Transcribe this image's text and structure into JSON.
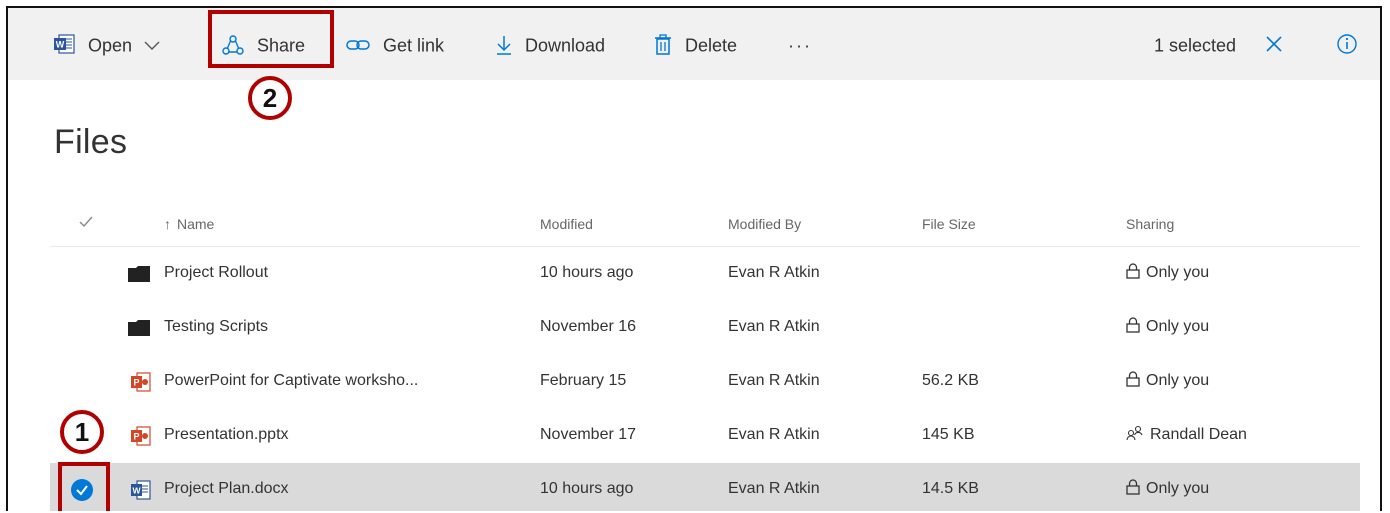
{
  "toolbar": {
    "open_label": "Open",
    "share_label": "Share",
    "get_link_label": "Get link",
    "download_label": "Download",
    "delete_label": "Delete",
    "more_label": "···",
    "selection_status": "1 selected"
  },
  "page_title": "Files",
  "columns": {
    "name": "Name",
    "modified": "Modified",
    "modified_by": "Modified By",
    "file_size": "File Size",
    "sharing": "Sharing"
  },
  "rows": [
    {
      "name": "Project Rollout",
      "modified": "10 hours ago",
      "modified_by": "Evan R Atkin",
      "size": "",
      "sharing": "Only you",
      "type": "folder-icon"
    },
    {
      "name": "Testing Scripts",
      "modified": "November 16",
      "modified_by": "Evan R Atkin",
      "size": "",
      "sharing": "Only you",
      "type": "folder-icon"
    },
    {
      "name": "PowerPoint for Captivate worksho...",
      "modified": "February 15",
      "modified_by": "Evan R Atkin",
      "size": "56.2 KB",
      "sharing": "Only you",
      "type": "powerpoint-file-icon"
    },
    {
      "name": "Presentation.pptx",
      "modified": "November 17",
      "modified_by": "Evan R Atkin",
      "size": "145 KB",
      "sharing": "Randall Dean",
      "type": "powerpoint-file-icon"
    },
    {
      "name": "Project Plan.docx",
      "modified": "10 hours ago",
      "modified_by": "Evan R Atkin",
      "size": "14.5 KB",
      "sharing": "Only you",
      "type": "word-file-icon",
      "selected": true
    }
  ],
  "annotations": {
    "step1": "1",
    "step2": "2"
  },
  "colors": {
    "accent": "#0078d7",
    "annotation_red": "#b00000",
    "toolbar_bg": "#f1f1f1",
    "selected_row_bg": "#dadada",
    "powerpoint": "#d24726",
    "word": "#2b579a"
  }
}
